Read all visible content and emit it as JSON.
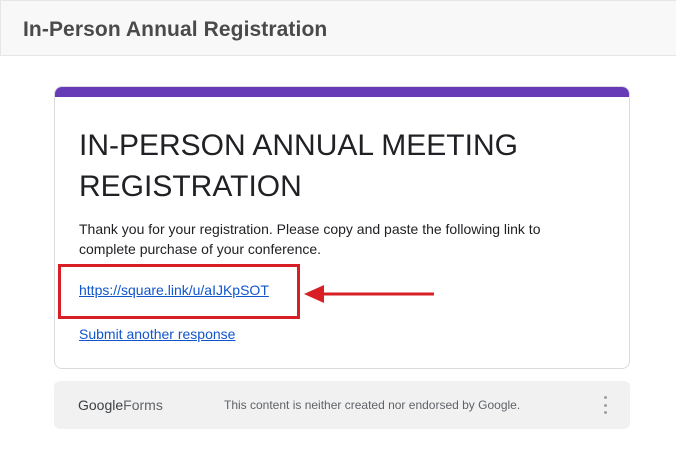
{
  "header": {
    "title": "In-Person Annual Registration"
  },
  "form": {
    "title": "IN-PERSON ANNUAL MEETING REGISTRATION",
    "confirmation_message": "Thank you for your registration. Please copy and paste the following link to complete purchase of your conference.",
    "purchase_link": "https://square.link/u/aIJKpSOT",
    "submit_another": "Submit another response",
    "accent_color": "#673ab7"
  },
  "annotation": {
    "highlight_color": "#d91f26"
  },
  "footer": {
    "logo_google": "Google",
    "logo_forms": "Forms",
    "disclaimer": "This content is neither created nor endorsed by Google.",
    "more_icon": "more-vert-icon"
  }
}
